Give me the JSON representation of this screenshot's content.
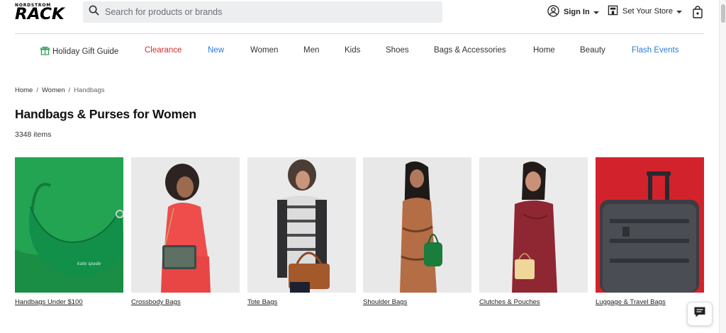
{
  "brand": {
    "logo_top": "NORDSTROM",
    "logo_main": "RACK"
  },
  "search": {
    "placeholder": "Search for products or brands",
    "value": ""
  },
  "header": {
    "sign_in_label": "Sign In",
    "store_label": "Set Your Store"
  },
  "nav": {
    "items": [
      {
        "label": "Holiday Gift Guide"
      },
      {
        "label": "Clearance",
        "color": "#d62b2b"
      },
      {
        "label": "New",
        "color": "#2c7bd6"
      },
      {
        "label": "Women"
      },
      {
        "label": "Men"
      },
      {
        "label": "Kids"
      },
      {
        "label": "Shoes"
      },
      {
        "label": "Bags & Accessories"
      },
      {
        "label": "Home"
      },
      {
        "label": "Beauty"
      },
      {
        "label": "Flash Events",
        "color": "#2c7bd6"
      }
    ]
  },
  "breadcrumb": {
    "items": [
      {
        "label": "Home"
      },
      {
        "label": "Women"
      },
      {
        "label": "Handbags"
      }
    ],
    "separator": "/"
  },
  "page": {
    "title": "Handbags & Purses for Women",
    "count": "3348 items"
  },
  "categories": [
    {
      "label": "Handbags Under $100",
      "bg": "#1fa04f"
    },
    {
      "label": "Crossbody Bags",
      "bg": "#e9e9ea"
    },
    {
      "label": "Tote Bags",
      "bg": "#eaeaeb"
    },
    {
      "label": "Shoulder Bags",
      "bg": "#e8e8e9"
    },
    {
      "label": "Clutches & Pouches",
      "bg": "#ebebec"
    },
    {
      "label": "Luggage & Travel Bags",
      "bg": "#d2222c"
    }
  ],
  "icons": {
    "search": "search-icon",
    "user": "user-icon",
    "store": "store-icon",
    "bag": "shopping-bag-icon",
    "gift": "gift-icon",
    "chat": "chat-icon"
  }
}
